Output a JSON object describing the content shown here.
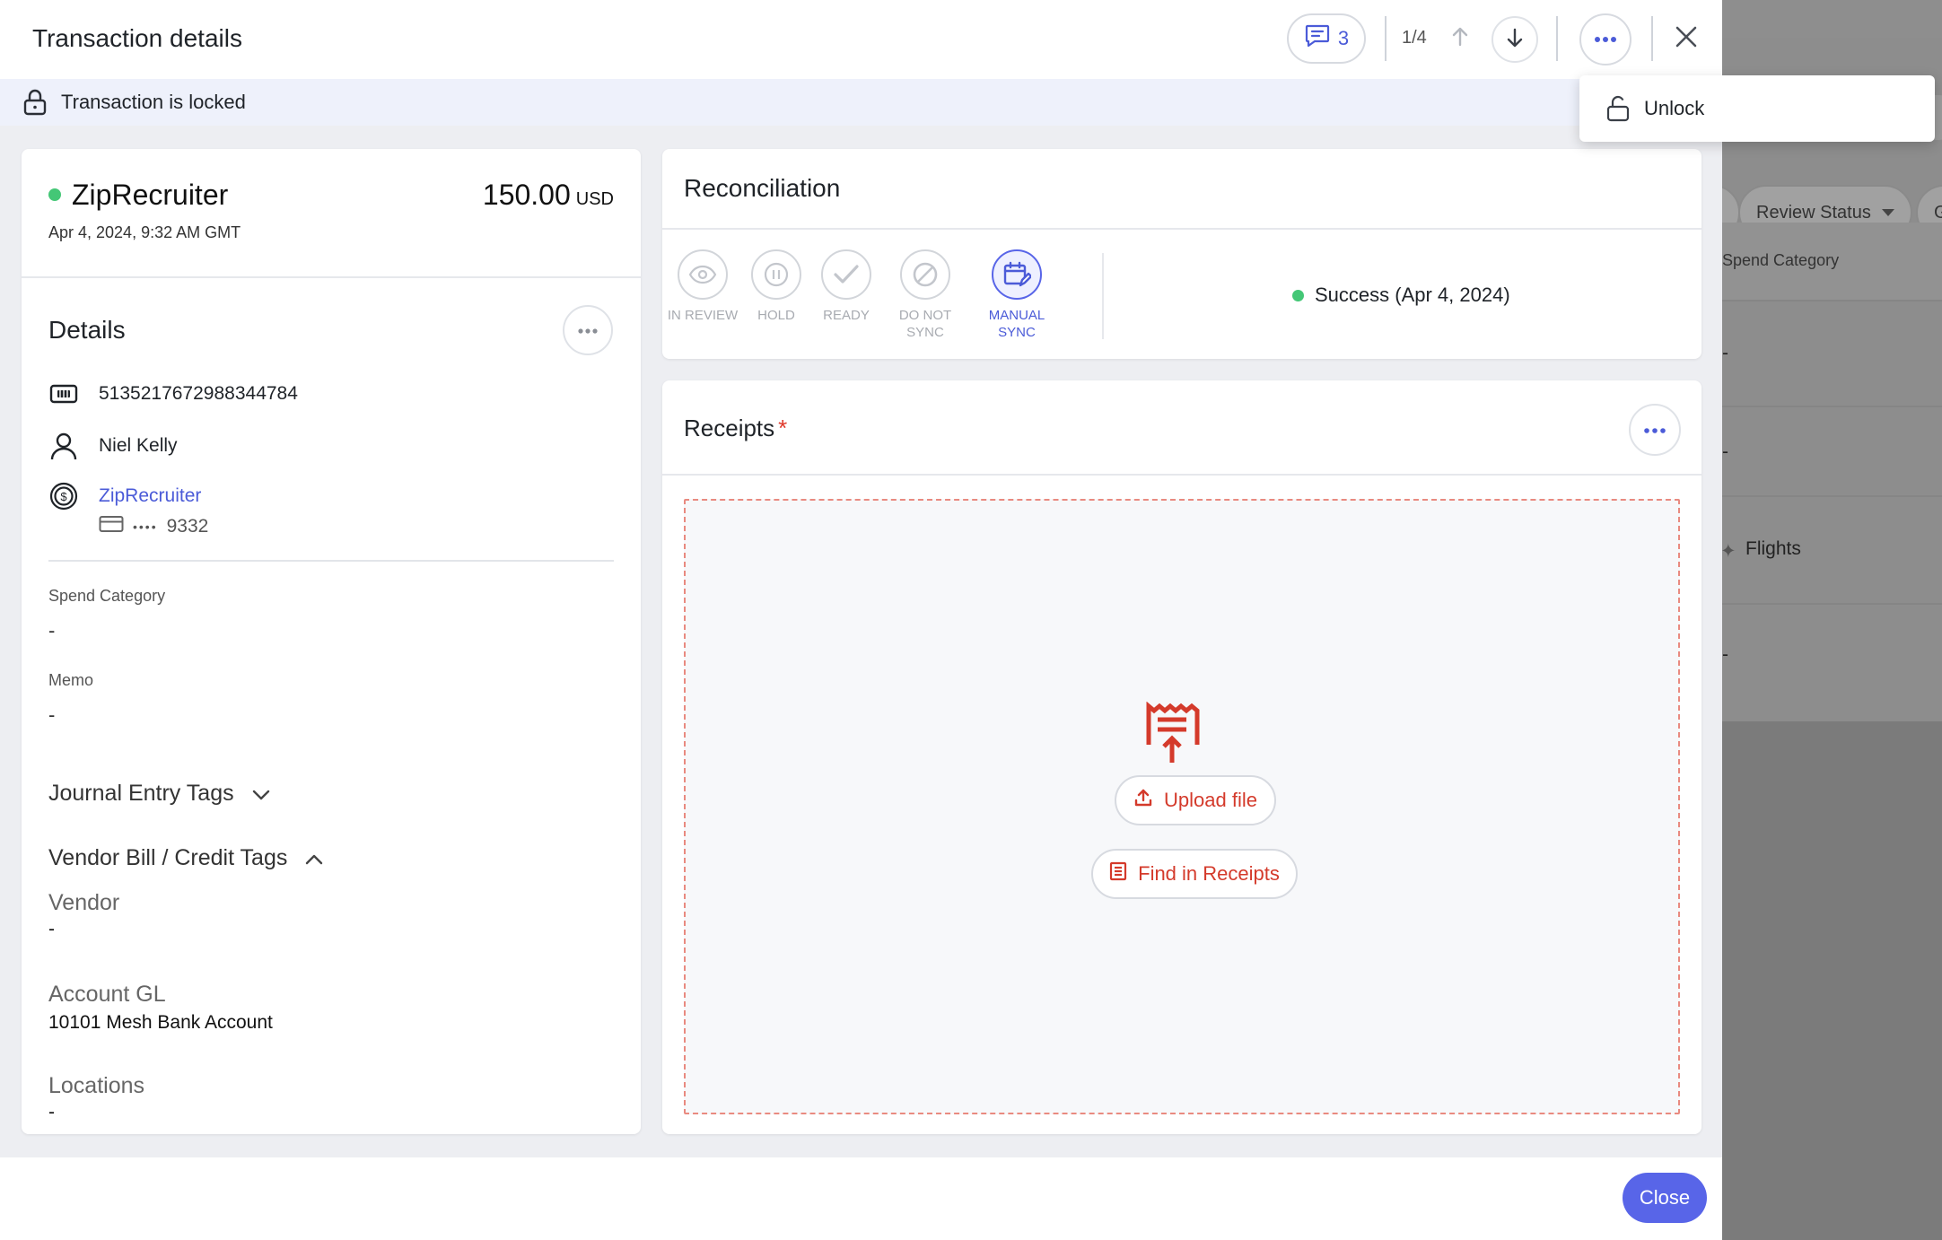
{
  "modal": {
    "title": "Transaction details",
    "comments_count": "3",
    "pagination": "1/4",
    "lock_banner": "Transaction is locked",
    "close_button": "Close"
  },
  "menu": {
    "unlock_label": "Unlock"
  },
  "transaction": {
    "merchant": "ZipRecruiter",
    "date": "Apr 4, 2024, 9:32 AM GMT",
    "amount": "150.00",
    "currency": "USD",
    "status_color": "#44c776"
  },
  "details": {
    "title": "Details",
    "card_number": "5135217672988344784",
    "cardholder": "Niel Kelly",
    "vendor_link": "ZipRecruiter",
    "card_dots": "••••",
    "card_last4": "9332",
    "spend_category_label": "Spend Category",
    "spend_category_value": "-",
    "memo_label": "Memo",
    "memo_value": "-",
    "journal_tags_label": "Journal Entry Tags",
    "vendor_bill_tags_label": "Vendor Bill / Credit Tags",
    "vendor_label": "Vendor",
    "vendor_value": "-",
    "account_gl_label": "Account GL",
    "account_gl_value": "10101 Mesh Bank Account",
    "locations_label": "Locations",
    "locations_value": "-"
  },
  "reconciliation": {
    "title": "Reconciliation",
    "steps": [
      {
        "line1": "IN REVIEW",
        "line2": "",
        "icon": "eye-icon",
        "active": false
      },
      {
        "line1": "HOLD",
        "line2": "",
        "icon": "pause-icon",
        "active": false
      },
      {
        "line1": "READY",
        "line2": "",
        "icon": "check-icon",
        "active": false
      },
      {
        "line1": "DO NOT",
        "line2": "SYNC",
        "icon": "ban-icon",
        "active": false
      },
      {
        "line1": "MANUAL",
        "line2": "SYNC",
        "icon": "calendar-edit-icon",
        "active": true
      }
    ],
    "status": "Success (Apr 4, 2024)"
  },
  "receipts": {
    "title": "Receipts",
    "required_mark": "*",
    "upload_button": "Upload file",
    "find_button": "Find in Receipts"
  },
  "background": {
    "filter_review_status": "Review Status",
    "filter_partial": "G",
    "column_spend_category": "Spend Category",
    "rows": [
      "-",
      "-",
      "Flights",
      "-"
    ]
  },
  "colors": {
    "accent": "#5865e8",
    "danger": "#d43a2b",
    "success": "#44c776"
  }
}
